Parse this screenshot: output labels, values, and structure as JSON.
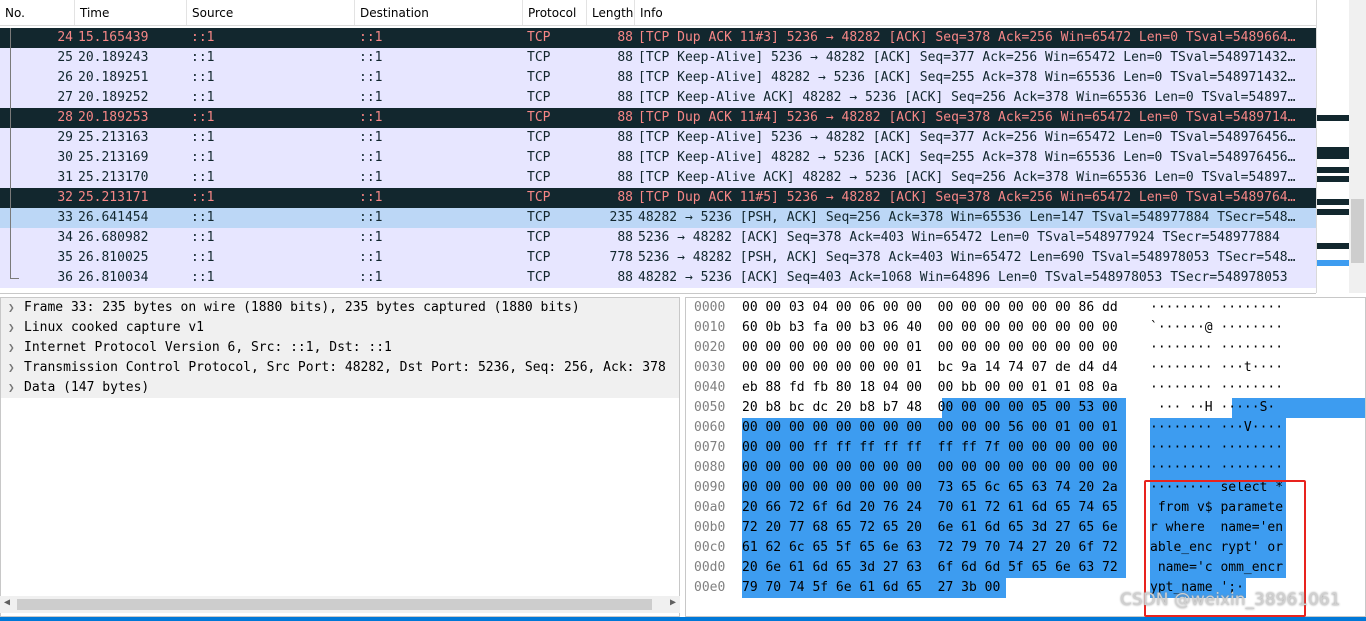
{
  "columns": [
    "No.",
    "Time",
    "Source",
    "Destination",
    "Protocol",
    "Length",
    "Info"
  ],
  "packets": [
    {
      "no": "24",
      "time": "15.165439",
      "src": "::1",
      "dst": "::1",
      "proto": "TCP",
      "len": "88",
      "info": "[TCP Dup ACK 11#3] 5236 → 48282 [ACK] Seq=378 Ack=256 Win=65472 Len=0 TSval=5489664…",
      "style": "dup"
    },
    {
      "no": "25",
      "time": "20.189243",
      "src": "::1",
      "dst": "::1",
      "proto": "TCP",
      "len": "88",
      "info": "[TCP Keep-Alive] 5236 → 48282 [ACK] Seq=377 Ack=256 Win=65472 Len=0 TSval=548971432…",
      "style": "ka"
    },
    {
      "no": "26",
      "time": "20.189251",
      "src": "::1",
      "dst": "::1",
      "proto": "TCP",
      "len": "88",
      "info": "[TCP Keep-Alive] 48282 → 5236 [ACK] Seq=255 Ack=378 Win=65536 Len=0 TSval=548971432…",
      "style": "ka"
    },
    {
      "no": "27",
      "time": "20.189252",
      "src": "::1",
      "dst": "::1",
      "proto": "TCP",
      "len": "88",
      "info": "[TCP Keep-Alive ACK] 48282 → 5236 [ACK] Seq=256 Ack=378 Win=65536 Len=0 TSval=54897…",
      "style": "ka"
    },
    {
      "no": "28",
      "time": "20.189253",
      "src": "::1",
      "dst": "::1",
      "proto": "TCP",
      "len": "88",
      "info": "[TCP Dup ACK 11#4] 5236 → 48282 [ACK] Seq=378 Ack=256 Win=65472 Len=0 TSval=5489714…",
      "style": "dup"
    },
    {
      "no": "29",
      "time": "25.213163",
      "src": "::1",
      "dst": "::1",
      "proto": "TCP",
      "len": "88",
      "info": "[TCP Keep-Alive] 5236 → 48282 [ACK] Seq=377 Ack=256 Win=65472 Len=0 TSval=548976456…",
      "style": "ka"
    },
    {
      "no": "30",
      "time": "25.213169",
      "src": "::1",
      "dst": "::1",
      "proto": "TCP",
      "len": "88",
      "info": "[TCP Keep-Alive] 48282 → 5236 [ACK] Seq=255 Ack=378 Win=65536 Len=0 TSval=548976456…",
      "style": "ka"
    },
    {
      "no": "31",
      "time": "25.213170",
      "src": "::1",
      "dst": "::1",
      "proto": "TCP",
      "len": "88",
      "info": "[TCP Keep-Alive ACK] 48282 → 5236 [ACK] Seq=256 Ack=378 Win=65536 Len=0 TSval=54897…",
      "style": "ka"
    },
    {
      "no": "32",
      "time": "25.213171",
      "src": "::1",
      "dst": "::1",
      "proto": "TCP",
      "len": "88",
      "info": "[TCP Dup ACK 11#5] 5236 → 48282 [ACK] Seq=378 Ack=256 Win=65472 Len=0 TSval=5489764…",
      "style": "dup"
    },
    {
      "no": "33",
      "time": "26.641454",
      "src": "::1",
      "dst": "::1",
      "proto": "TCP",
      "len": "235",
      "info": "48282 → 5236 [PSH, ACK] Seq=256 Ack=378 Win=65536 Len=147 TSval=548977884 TSecr=548…",
      "style": "sel"
    },
    {
      "no": "34",
      "time": "26.680982",
      "src": "::1",
      "dst": "::1",
      "proto": "TCP",
      "len": "88",
      "info": "5236 → 48282 [ACK] Seq=378 Ack=403 Win=65472 Len=0 TSval=548977924 TSecr=548977884",
      "style": "tcp"
    },
    {
      "no": "35",
      "time": "26.810025",
      "src": "::1",
      "dst": "::1",
      "proto": "TCP",
      "len": "778",
      "info": "5236 → 48282 [PSH, ACK] Seq=378 Ack=403 Win=65472 Len=690 TSval=548978053 TSecr=548…",
      "style": "tcp"
    },
    {
      "no": "36",
      "time": "26.810034",
      "src": "::1",
      "dst": "::1",
      "proto": "TCP",
      "len": "88",
      "info": "48282 → 5236 [ACK] Seq=403 Ack=1068 Win=64896 Len=0 TSval=548978053 TSecr=548978053",
      "style": "tcp"
    }
  ],
  "details": [
    "Frame 33: 235 bytes on wire (1880 bits), 235 bytes captured (1880 bits)",
    "Linux cooked capture v1",
    "Internet Protocol Version 6, Src: ::1, Dst: ::1",
    "Transmission Control Protocol, Src Port: 48282, Dst Port: 5236, Seq: 256, Ack: 378",
    "Data (147 bytes)"
  ],
  "bytes": [
    {
      "off": "0000",
      "hex": "00 00 03 04 00 06 00 00  00 00 00 00 00 00 86 dd",
      "ascii": "········ ········",
      "sel": null
    },
    {
      "off": "0010",
      "hex": "60 0b b3 fa 00 b3 06 40  00 00 00 00 00 00 00 00",
      "ascii": "`······@ ········",
      "sel": null
    },
    {
      "off": "0020",
      "hex": "00 00 00 00 00 00 00 01  00 00 00 00 00 00 00 00",
      "ascii": "········ ········",
      "sel": null
    },
    {
      "off": "0030",
      "hex": "00 00 00 00 00 00 00 01  bc 9a 14 74 07 de d4 d4",
      "ascii": "········ ···t····",
      "sel": null
    },
    {
      "off": "0040",
      "hex": "eb 88 fd fb 80 18 04 00  00 bb 00 00 01 01 08 0a",
      "ascii": "········ ········",
      "sel": null
    },
    {
      "off": "0050",
      "hex": "20 b8 bc dc 20 b8 b7 48  00 00 00 00 05 00 53 00",
      "ascii": " ··· ··H ·····S·",
      "sel": "half"
    },
    {
      "off": "0060",
      "hex": "00 00 00 00 00 00 00 00  00 00 00 56 00 01 00 01",
      "ascii": "········ ···V····",
      "sel": "full"
    },
    {
      "off": "0070",
      "hex": "00 00 00 ff ff ff ff ff  ff ff 7f 00 00 00 00 00",
      "ascii": "········ ········",
      "sel": "full"
    },
    {
      "off": "0080",
      "hex": "00 00 00 00 00 00 00 00  00 00 00 00 00 00 00 00",
      "ascii": "········ ········",
      "sel": "full"
    },
    {
      "off": "0090",
      "hex": "00 00 00 00 00 00 00 00  73 65 6c 65 63 74 20 2a",
      "ascii": "········ select *",
      "sel": "full"
    },
    {
      "off": "00a0",
      "hex": "20 66 72 6f 6d 20 76 24  70 61 72 61 6d 65 74 65",
      "ascii": " from v$ paramete",
      "sel": "full"
    },
    {
      "off": "00b0",
      "hex": "72 20 77 68 65 72 65 20  6e 61 6d 65 3d 27 65 6e",
      "ascii": "r where  name='en",
      "sel": "full"
    },
    {
      "off": "00c0",
      "hex": "61 62 6c 65 5f 65 6e 63  72 79 70 74 27 20 6f 72",
      "ascii": "able_enc rypt' or",
      "sel": "full"
    },
    {
      "off": "00d0",
      "hex": "20 6e 61 6d 65 3d 27 63  6f 6d 6d 5f 65 6e 63 72",
      "ascii": " name='c omm_encr",
      "sel": "full"
    },
    {
      "off": "00e0",
      "hex": "79 70 74 5f 6e 61 6d 65  27 3b 00",
      "ascii": "ypt_name ';·",
      "sel": "end"
    }
  ],
  "watermark": "CSDN @weixin_38961061",
  "colors": {
    "dup_bg": "#12272e",
    "dup_fg": "#f78787",
    "keepalive_bg": "#e7e6ff",
    "selected_bg": "#bcd7f6",
    "bytes_sel": "#3d9cf0",
    "annotation": "#e8231e"
  }
}
